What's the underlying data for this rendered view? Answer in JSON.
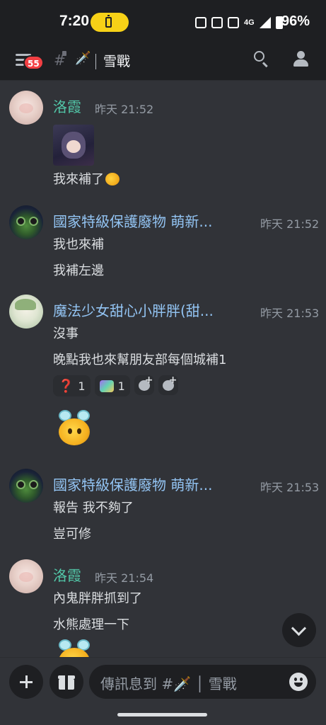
{
  "status_bar": {
    "time": "7:20",
    "battery_percent": "96%",
    "network": "4G"
  },
  "header": {
    "notification_count": "55",
    "channel_emoji": "🗡️",
    "channel_name": "雪戰"
  },
  "messages": [
    {
      "author": "洛霞",
      "timestamp": "昨天 21:52",
      "lines": [
        "我來補了"
      ]
    },
    {
      "author": "國家特級保護廢物 萌新...",
      "timestamp": "昨天 21:52",
      "lines": [
        "我也來補",
        "我補左邊"
      ]
    },
    {
      "author": "魔法少女甜心小胖胖(甜...",
      "timestamp": "昨天 21:53",
      "lines": [
        "沒事",
        "晚點我也來幫朋友部每個城補1"
      ],
      "reactions": [
        {
          "emoji": "❓",
          "count": "1"
        },
        {
          "emoji": "image-emoji",
          "count": "1"
        }
      ]
    },
    {
      "author": "國家特級保護廢物 萌新...",
      "timestamp": "昨天 21:53",
      "lines": [
        "報告 我不夠了",
        "豈可修"
      ]
    },
    {
      "author": "洛霞",
      "timestamp": "昨天 21:54",
      "lines": [
        "內鬼胖胖抓到了",
        "水熊處理一下"
      ]
    }
  ],
  "composer": {
    "placeholder": "傳訊息到 #🗡️ │ 雪戰"
  },
  "colors": {
    "background": "#313338",
    "header": "#1e1f22",
    "badge": "#f23f43",
    "battery_pill": "#f7d117"
  },
  "icons": [
    "menu-icon",
    "search-icon",
    "members-icon",
    "plus-icon",
    "gift-icon",
    "emoji-icon",
    "chevron-down-icon"
  ]
}
